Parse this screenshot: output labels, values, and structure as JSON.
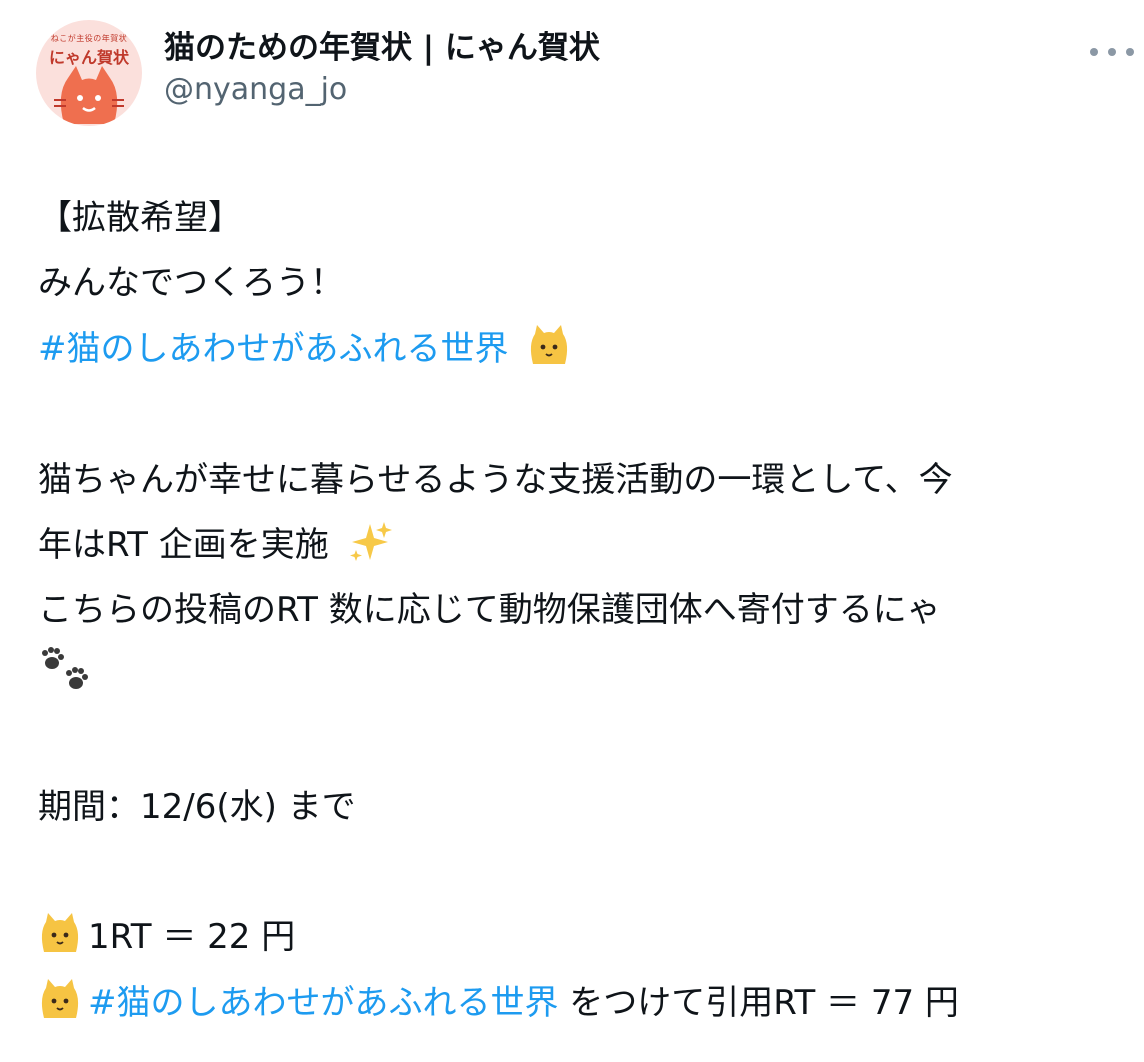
{
  "author": {
    "avatar_caption": "ねこが主役の年賀状",
    "avatar_title": "にゃん賀状",
    "display_name": "猫のための年賀状 | にゃん賀状",
    "handle": "@nyanga_jo"
  },
  "tweet": {
    "line1": "【拡散希望】",
    "line2": "みんなでつくろう！",
    "hashtag1": "#猫のしあわせがあふれる世界",
    "body1": "猫ちゃんが幸せに暮らせるような支援活動の一環として、今",
    "body2": "年はRT 企画を実施",
    "body3": "こちらの投稿のRT 数に応じて動物保護団体へ寄付するにゃ",
    "period": "期間：12/6(水) まで",
    "rate1": "1RT ＝ 22 円",
    "hashtag2": "#猫のしあわせがあふれる世界",
    "rate2_suffix": " をつけて引用RT ＝ 77 円"
  },
  "icons": {
    "more": "more-dots-icon",
    "cat": "cat-face-emoji",
    "sparkles": "sparkles-emoji",
    "paws": "paw-prints-emoji"
  },
  "colors": {
    "text": "#0f1419",
    "handle": "#536471",
    "hashtag": "#1d9bf0",
    "avatar_bg": "#fbe0dc",
    "avatar_cat": "#ef6f4f",
    "emoji_cat": "#f6c443"
  }
}
